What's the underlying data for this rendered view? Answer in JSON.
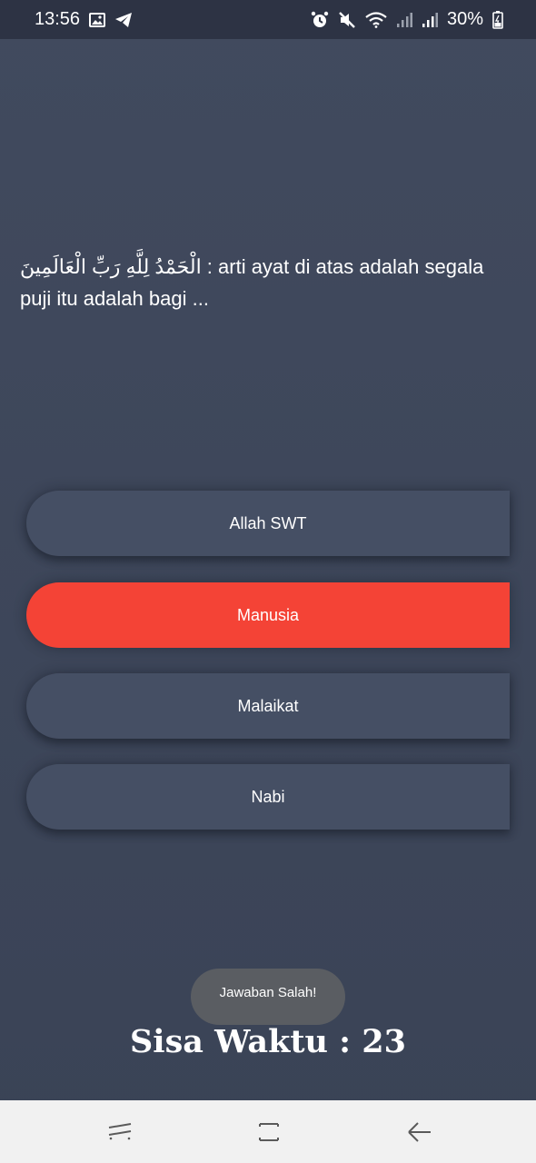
{
  "status_bar": {
    "time": "13:56",
    "battery": "30%",
    "icons_left": [
      "image-icon",
      "telegram-icon"
    ],
    "icons_right": [
      "alarm-icon",
      "mute-icon",
      "wifi-icon",
      "signal-icon",
      "signal-icon",
      "battery-icon"
    ]
  },
  "question": {
    "arabic": "الْحَمْدُ لِلَّهِ رَبِّ الْعَالَمِينَ",
    "text": " : arti ayat di atas adalah segala puji itu adalah bagi ..."
  },
  "answers": [
    {
      "label": "Allah SWT",
      "state": "default"
    },
    {
      "label": "Manusia",
      "state": "wrong"
    },
    {
      "label": "Malaikat",
      "state": "default"
    },
    {
      "label": "Nabi",
      "state": "default"
    }
  ],
  "colors": {
    "background": "#3e4659",
    "button": "#454f64",
    "wrong": "#f44336",
    "status_bar": "#2d3344",
    "nav_bar": "#f1f1f1"
  },
  "toast": {
    "text": "Jawaban Salah!"
  },
  "timer": {
    "label": "Sisa Waktu : 23"
  },
  "nav": {
    "recent_icon": "recent-apps-icon",
    "home_icon": "home-icon",
    "back_icon": "back-icon"
  }
}
